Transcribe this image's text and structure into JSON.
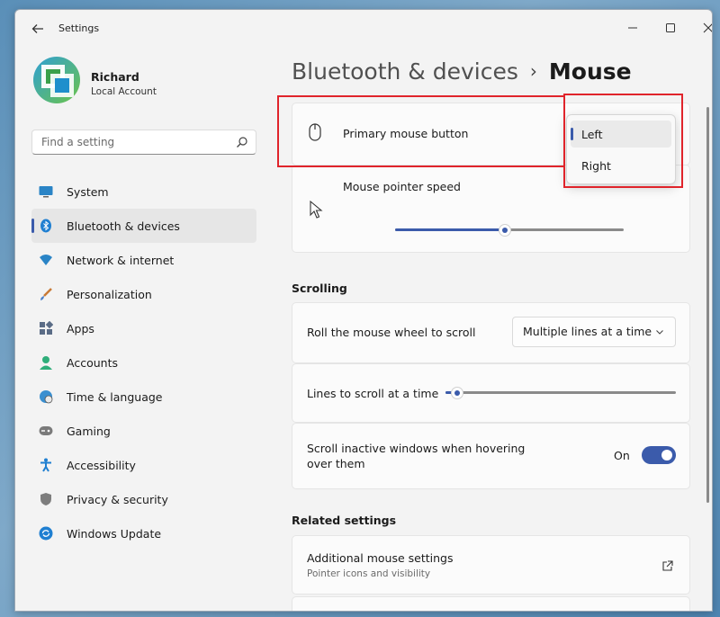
{
  "window": {
    "title": "Settings"
  },
  "profile": {
    "name": "Richard",
    "account": "Local Account"
  },
  "search": {
    "placeholder": "Find a setting"
  },
  "nav": [
    {
      "label": "System",
      "icon": "monitor-icon"
    },
    {
      "label": "Bluetooth & devices",
      "icon": "bluetooth-icon",
      "active": true
    },
    {
      "label": "Network & internet",
      "icon": "wifi-icon"
    },
    {
      "label": "Personalization",
      "icon": "brush-icon"
    },
    {
      "label": "Apps",
      "icon": "apps-icon"
    },
    {
      "label": "Accounts",
      "icon": "person-icon"
    },
    {
      "label": "Time & language",
      "icon": "globe-clock-icon"
    },
    {
      "label": "Gaming",
      "icon": "gamepad-icon"
    },
    {
      "label": "Accessibility",
      "icon": "accessibility-icon"
    },
    {
      "label": "Privacy & security",
      "icon": "shield-icon"
    },
    {
      "label": "Windows Update",
      "icon": "update-icon"
    }
  ],
  "breadcrumb": {
    "parent": "Bluetooth & devices",
    "separator": "›",
    "current": "Mouse"
  },
  "mouse": {
    "primary_button_label": "Primary mouse button",
    "pointer_speed_label": "Mouse pointer speed",
    "pointer_speed_value": 0.48
  },
  "dropdown": {
    "options": [
      "Left",
      "Right"
    ],
    "selected": "Left"
  },
  "scrolling": {
    "heading": "Scrolling",
    "roll_label": "Roll the mouse wheel to scroll",
    "roll_value": "Multiple lines at a time",
    "lines_label": "Lines to scroll at a time",
    "lines_value": 0.05,
    "inactive_label_line1": "Scroll inactive windows when hovering",
    "inactive_label_line2": "over them",
    "inactive_state": "On"
  },
  "related": {
    "heading": "Related settings",
    "additional_title": "Additional mouse settings",
    "additional_sub": "Pointer icons and visibility"
  },
  "colors": {
    "accent": "#3b5bab",
    "highlight": "#e0242b"
  }
}
